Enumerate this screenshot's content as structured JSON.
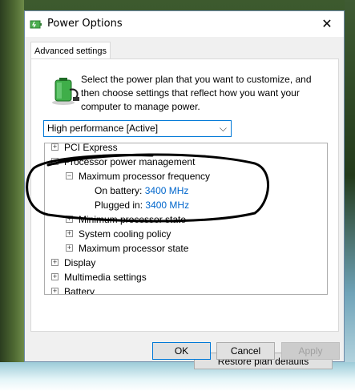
{
  "window": {
    "title": "Power Options",
    "close_glyph": "✕"
  },
  "tab": {
    "label": "Advanced settings"
  },
  "intro": {
    "text": "Select the power plan that you want to customize, and then choose settings that reflect how you want your computer to manage power."
  },
  "plan_select": {
    "value": "High performance [Active]",
    "chevron": "⌵"
  },
  "tree": {
    "pci_express": "PCI Express",
    "processor_power_management": "Processor power management",
    "max_freq": "Maximum processor frequency",
    "on_battery_label": "On battery:",
    "on_battery_value": "3400 MHz",
    "plugged_in_label": "Plugged in:",
    "plugged_in_value": "3400 MHz",
    "min_state": "Minimum processor state",
    "cooling_policy": "System cooling policy",
    "max_state": "Maximum processor state",
    "display": "Display",
    "multimedia": "Multimedia settings",
    "battery": "Battery",
    "plus": "+",
    "minus": "−"
  },
  "scrollbar": {
    "up": "▲",
    "down": "▼"
  },
  "buttons": {
    "restore": "Restore plan defaults",
    "ok": "OK",
    "cancel": "Cancel",
    "apply": "Apply"
  },
  "colors": {
    "accent": "#0078d7",
    "link": "#0066cc"
  }
}
